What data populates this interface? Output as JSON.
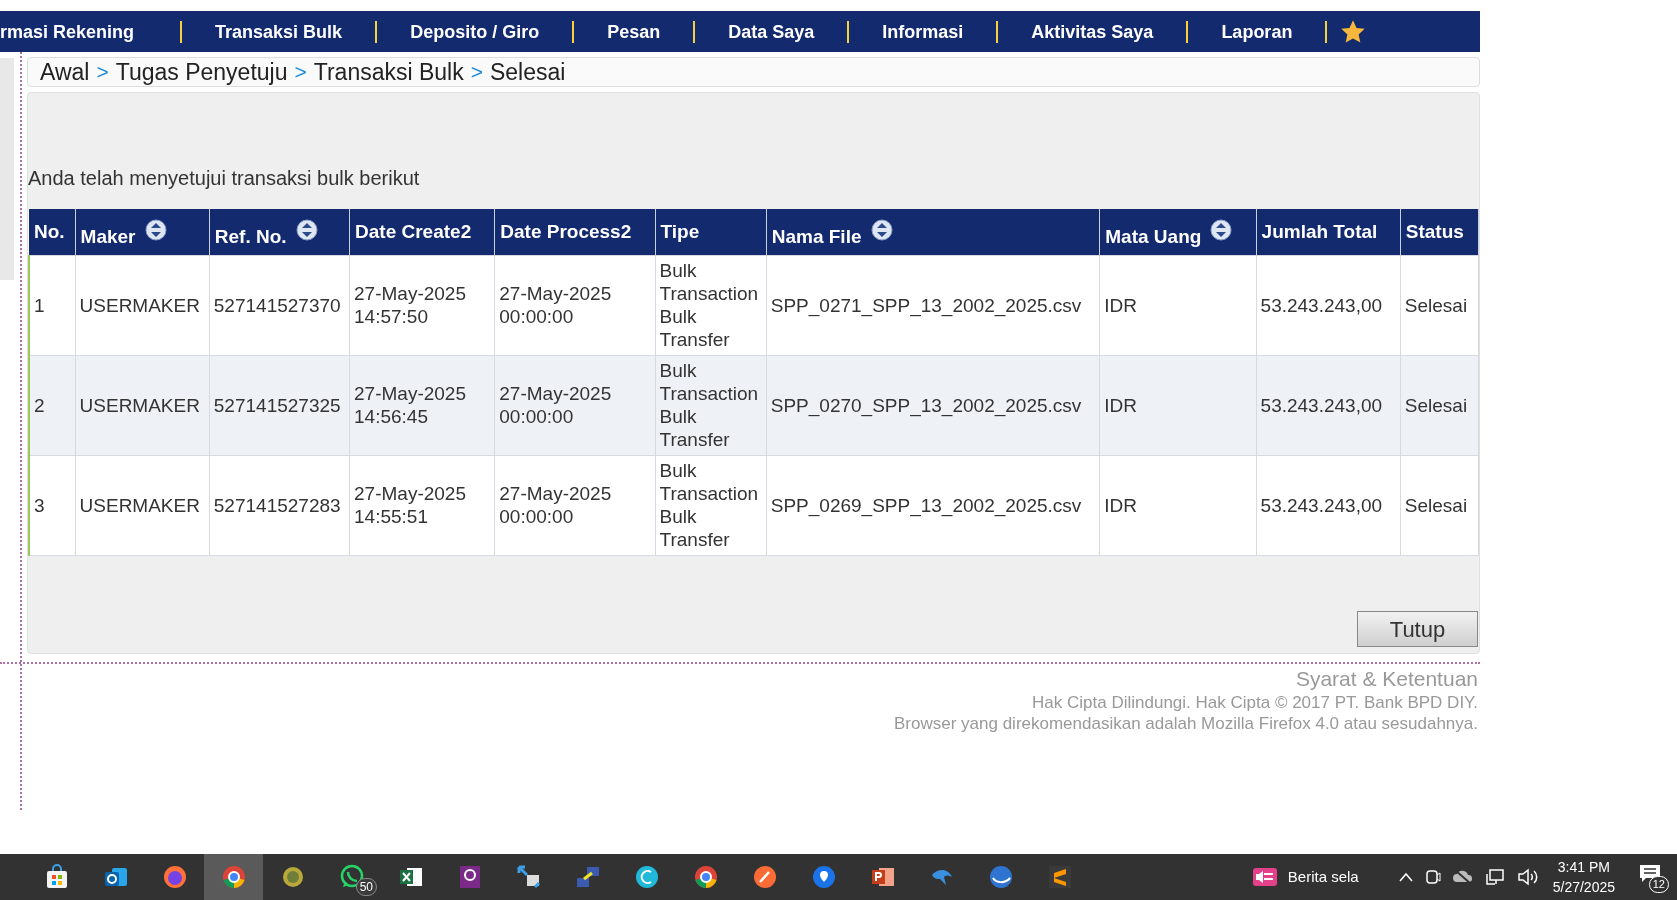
{
  "nav": {
    "items": [
      {
        "label": "rmasi Rekening"
      },
      {
        "label": "Transaksi Bulk"
      },
      {
        "label": "Deposito / Giro"
      },
      {
        "label": "Pesan"
      },
      {
        "label": "Data Saya"
      },
      {
        "label": "Informasi"
      },
      {
        "label": "Aktivitas Saya"
      },
      {
        "label": "Laporan"
      }
    ]
  },
  "breadcrumb": [
    {
      "kind": "link",
      "text": "Awal"
    },
    {
      "kind": "separator",
      "text": ">"
    },
    {
      "kind": "link",
      "text": "Tugas Penyetuju"
    },
    {
      "kind": "separator",
      "text": ">"
    },
    {
      "kind": "link",
      "text": "Transaksi Bulk"
    },
    {
      "kind": "separator",
      "text": ">"
    },
    {
      "kind": "link",
      "text": "Selesai"
    }
  ],
  "message": "Anda telah menyetujui transaksi bulk berikut",
  "table": {
    "columns": [
      {
        "label": "No.",
        "sortable": false
      },
      {
        "label": "Maker",
        "sortable": true
      },
      {
        "label": "Ref. No.",
        "sortable": true
      },
      {
        "label": "Date Create2",
        "sortable": false
      },
      {
        "label": "Date Process2",
        "sortable": false
      },
      {
        "label": "Tipe",
        "sortable": false
      },
      {
        "label": "Nama File",
        "sortable": true
      },
      {
        "label": "Mata Uang",
        "sortable": true
      },
      {
        "label": "Jumlah Total",
        "sortable": false
      },
      {
        "label": "Status",
        "sortable": false
      }
    ],
    "rows": [
      {
        "cells": [
          "1",
          "USERMAKER",
          "527141527370",
          "27-May-2025 14:57:50",
          "27-May-2025 00:00:00",
          "Bulk Transaction Bulk Transfer",
          "SPP_0271_SPP_13_2002_2025.csv",
          "IDR",
          "53.243.243,00",
          "Selesai"
        ]
      },
      {
        "cells": [
          "2",
          "USERMAKER",
          "527141527325",
          "27-May-2025 14:56:45",
          "27-May-2025 00:00:00",
          "Bulk Transaction Bulk Transfer",
          "SPP_0270_SPP_13_2002_2025.csv",
          "IDR",
          "53.243.243,00",
          "Selesai"
        ]
      },
      {
        "cells": [
          "3",
          "USERMAKER",
          "527141527283",
          "27-May-2025 14:55:51",
          "27-May-2025 00:00:00",
          "Bulk Transaction Bulk Transfer",
          "SPP_0269_SPP_13_2002_2025.csv",
          "IDR",
          "53.243.243,00",
          "Selesai"
        ]
      }
    ]
  },
  "close_button": "Tutup",
  "footer": {
    "terms": "Syarat & Ketentuan",
    "copyright": "Hak Cipta Dilindungi. Hak Cipta © 2017 PT. Bank BPD DIY.",
    "browser_note": "Browser yang direkomendasikan adalah Mozilla Firefox 4.0 atau sesudahnya."
  },
  "taskbar": {
    "apps": [
      {
        "kind": "store",
        "selected": false
      },
      {
        "kind": "mail",
        "selected": false
      },
      {
        "kind": "fox",
        "selected": false
      },
      {
        "kind": "chrome",
        "selected": true
      },
      {
        "kind": "coin",
        "selected": false
      },
      {
        "kind": "chat",
        "selected": false,
        "badge": "50"
      },
      {
        "kind": "sheet",
        "selected": false
      },
      {
        "kind": "pdf",
        "selected": false
      },
      {
        "kind": "transfer",
        "selected": false
      },
      {
        "kind": "network",
        "selected": false
      },
      {
        "kind": "canva",
        "selected": false
      },
      {
        "kind": "chrome",
        "selected": false
      },
      {
        "kind": "pen",
        "selected": false
      },
      {
        "kind": "pin",
        "selected": false
      },
      {
        "kind": "slides",
        "selected": false
      },
      {
        "kind": "dolphin",
        "selected": false
      },
      {
        "kind": "globe",
        "selected": false
      },
      {
        "kind": "sublime",
        "selected": false
      }
    ],
    "news": "Berita sela",
    "time": "3:41 PM",
    "date": "5/27/2025",
    "notifications": "12"
  }
}
